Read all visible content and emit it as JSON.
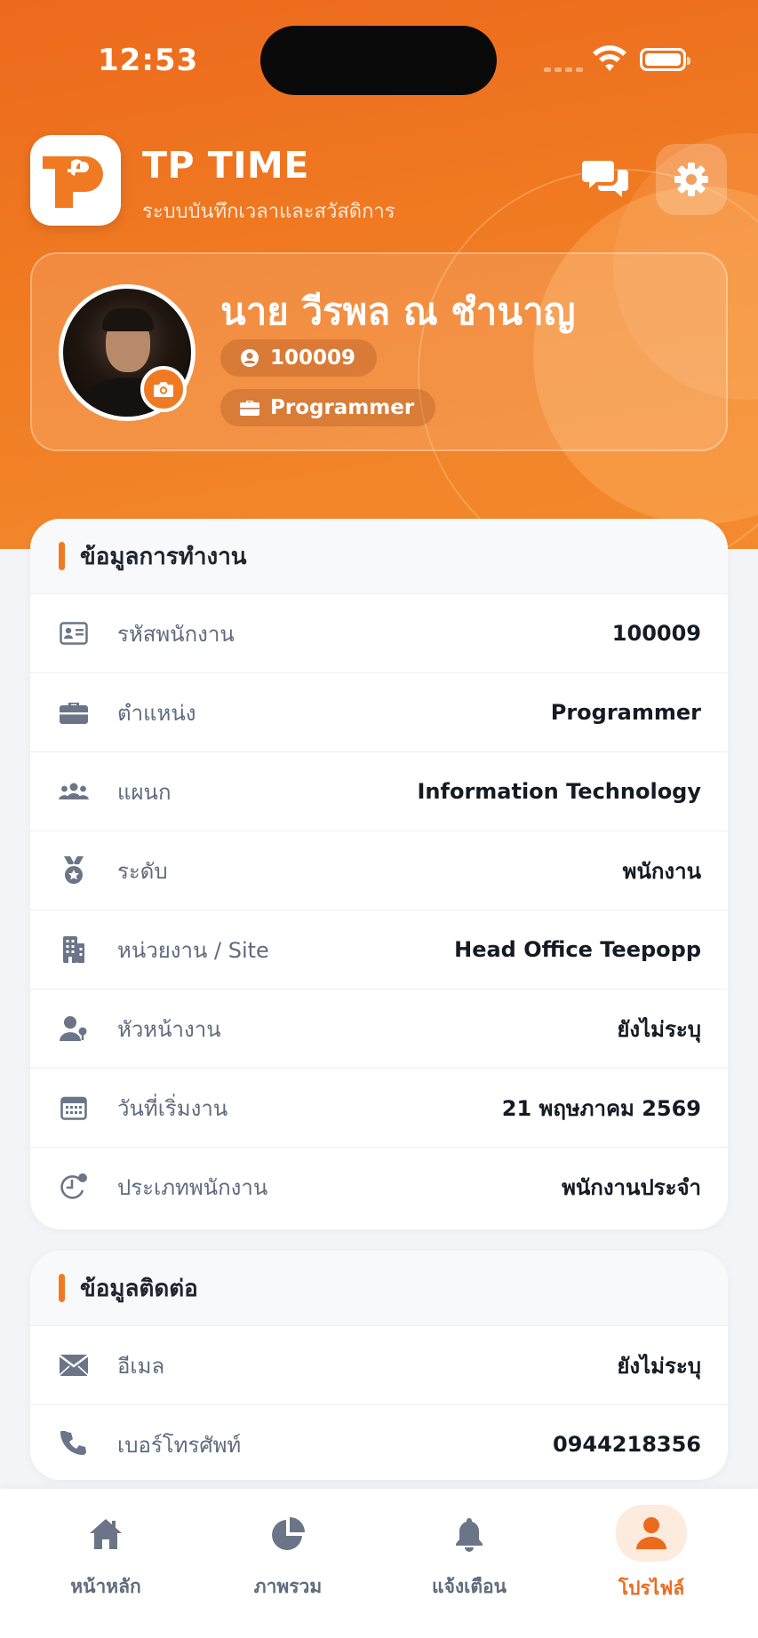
{
  "status_bar": {
    "time": "12:53"
  },
  "app": {
    "title": "TP TIME",
    "subtitle": "ระบบบันทึกเวลาและสวัสดิการ"
  },
  "profile": {
    "name": "นาย วีรพล ณ ชำนาญ",
    "employee_id": "100009",
    "position": "Programmer"
  },
  "work_info": {
    "title": "ข้อมูลการทำงาน",
    "rows": [
      {
        "icon": "id-card-icon",
        "label": "รหัสพนักงาน",
        "value": "100009"
      },
      {
        "icon": "briefcase-icon",
        "label": "ตำแหน่ง",
        "value": "Programmer"
      },
      {
        "icon": "users-icon",
        "label": "แผนก",
        "value": "Information Technology"
      },
      {
        "icon": "medal-icon",
        "label": "ระดับ",
        "value": "พนักงาน"
      },
      {
        "icon": "building-icon",
        "label": "หน่วยงาน / Site",
        "value": "Head Office Teepopp"
      },
      {
        "icon": "user-tie-icon",
        "label": "หัวหน้างาน",
        "value": "ยังไม่ระบุ"
      },
      {
        "icon": "calendar-icon",
        "label": "วันที่เริ่มงาน",
        "value": "21 พฤษภาคม 2569"
      },
      {
        "icon": "clock-badge-icon",
        "label": "ประเภทพนักงาน",
        "value": "พนักงานประจำ"
      }
    ]
  },
  "contact_info": {
    "title": "ข้อมูลติดต่อ",
    "rows": [
      {
        "icon": "envelope-icon",
        "label": "อีเมล",
        "value": "ยังไม่ระบุ"
      },
      {
        "icon": "phone-icon",
        "label": "เบอร์โทรศัพท์",
        "value": "0944218356"
      }
    ]
  },
  "bottom_nav": {
    "items": [
      {
        "icon": "home-icon",
        "label": "หน้าหลัก",
        "active": false
      },
      {
        "icon": "pie-chart-icon",
        "label": "ภาพรวม",
        "active": false
      },
      {
        "icon": "bell-icon",
        "label": "แจ้งเตือน",
        "active": false
      },
      {
        "icon": "user-icon",
        "label": "โปรไฟล์",
        "active": true
      }
    ]
  },
  "colors": {
    "brand_orange": "#f07a22",
    "active_nav_bg": "#fdebdd",
    "label_gray": "#5f6b7d"
  }
}
